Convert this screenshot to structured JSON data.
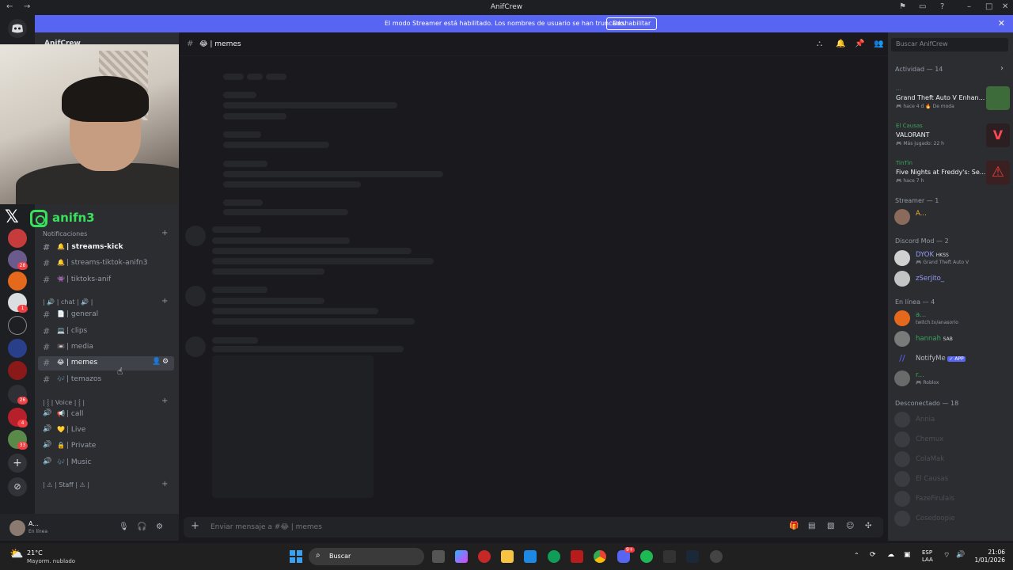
{
  "window": {
    "title": "AnifCrew"
  },
  "banner": {
    "message": "El modo Streamer está habilitado. Los nombres de usuario se han truncado.",
    "button": "Deshabilitar"
  },
  "server": {
    "name": "AnifCrew"
  },
  "overlay": {
    "handle": "anifn3"
  },
  "guild_badges": [
    "28",
    "1",
    "26",
    "4",
    "33"
  ],
  "sidebar": {
    "cat_notifications": "Notificaciones",
    "cat_chat": "| 🔊 | chat | 🔊 |",
    "cat_voice": "| ⸾ | Voice | ⸾ |",
    "cat_staff": "| ⚠ | Staff | ⚠ |",
    "notif_channels": [
      {
        "emoji": "🔔",
        "label": "| streams-kick"
      },
      {
        "emoji": "🔔",
        "label": "| streams-tiktok-anifn3"
      },
      {
        "emoji": "👾",
        "label": "| tiktoks-anif"
      }
    ],
    "chat_channels": [
      {
        "emoji": "📄",
        "label": "| general"
      },
      {
        "emoji": "💻",
        "label": "| clips"
      },
      {
        "emoji": "📼",
        "label": "| media"
      },
      {
        "emoji": "😂",
        "label": "| memes"
      },
      {
        "emoji": "🎶",
        "label": "| temazos"
      }
    ],
    "voice_channels": [
      {
        "emoji": "📢",
        "label": "| call"
      },
      {
        "emoji": "💛",
        "label": "| Live"
      },
      {
        "emoji": "🔒",
        "label": "| Private"
      },
      {
        "emoji": "🎶",
        "label": "| Music"
      }
    ]
  },
  "user": {
    "name": "A...",
    "status": "En línea"
  },
  "channel_header": {
    "name": "😂 | memes"
  },
  "composer": {
    "placeholder": "Enviar mensaje a #😂 | memes"
  },
  "members": {
    "search_placeholder": "Buscar AnifCrew",
    "activity_header": "Actividad — 14",
    "activities": [
      {
        "who": "...",
        "game": "Grand Theft Auto V Enhan...",
        "meta": "🎮 hace 4 d   🔥 De moda",
        "color": "#3d6b3a"
      },
      {
        "who": "El Causas",
        "game": "VALORANT",
        "meta": "🎮 Más jugado: 22 h",
        "color": "#2b1f22"
      },
      {
        "who": "TinTin",
        "game": "Five Nights at Freddy's: Se...",
        "meta": "🎮 hace 7 h",
        "color": "#3a2020"
      }
    ],
    "streamer_header": "Streamer — 1",
    "streamer": {
      "name": "A...",
      "color": "#f0b232"
    },
    "mod_header": "Discord Mod — 2",
    "mods": [
      {
        "name": "DYOK",
        "tag": "HKSS",
        "status": "🎮 Grand Theft Auto V",
        "color": "#949cf7"
      },
      {
        "name": "zSerjito_",
        "tag": "",
        "status": "",
        "color": "#949cf7"
      }
    ],
    "online_header": "En línea — 4",
    "online": [
      {
        "name": "a...",
        "tag": "",
        "status": "twitch.tv/anasorio",
        "color": "#3ba55d"
      },
      {
        "name": "hannah",
        "tag": "SAB",
        "status": "",
        "color": "#3ba55d"
      },
      {
        "name": "NotifyMe",
        "tag": "✓ APP",
        "status": "",
        "color": "#b5bac1"
      },
      {
        "name": "r...",
        "tag": "",
        "status": "🎮 Roblox",
        "color": "#3ba55d"
      }
    ],
    "offline_header": "Desconectado — 18",
    "offline": [
      "Annia",
      "Chemux",
      "ColaMak",
      "El Causas",
      "FazeFirulais",
      "Cosedoopie"
    ]
  },
  "taskbar": {
    "weather_temp": "21°C",
    "weather_desc": "Mayorm. nublado",
    "search": "Buscar",
    "lang1": "ESP",
    "lang2": "LAA",
    "time": "21:06",
    "date": "1/01/2026",
    "discord_badge": "9+"
  }
}
